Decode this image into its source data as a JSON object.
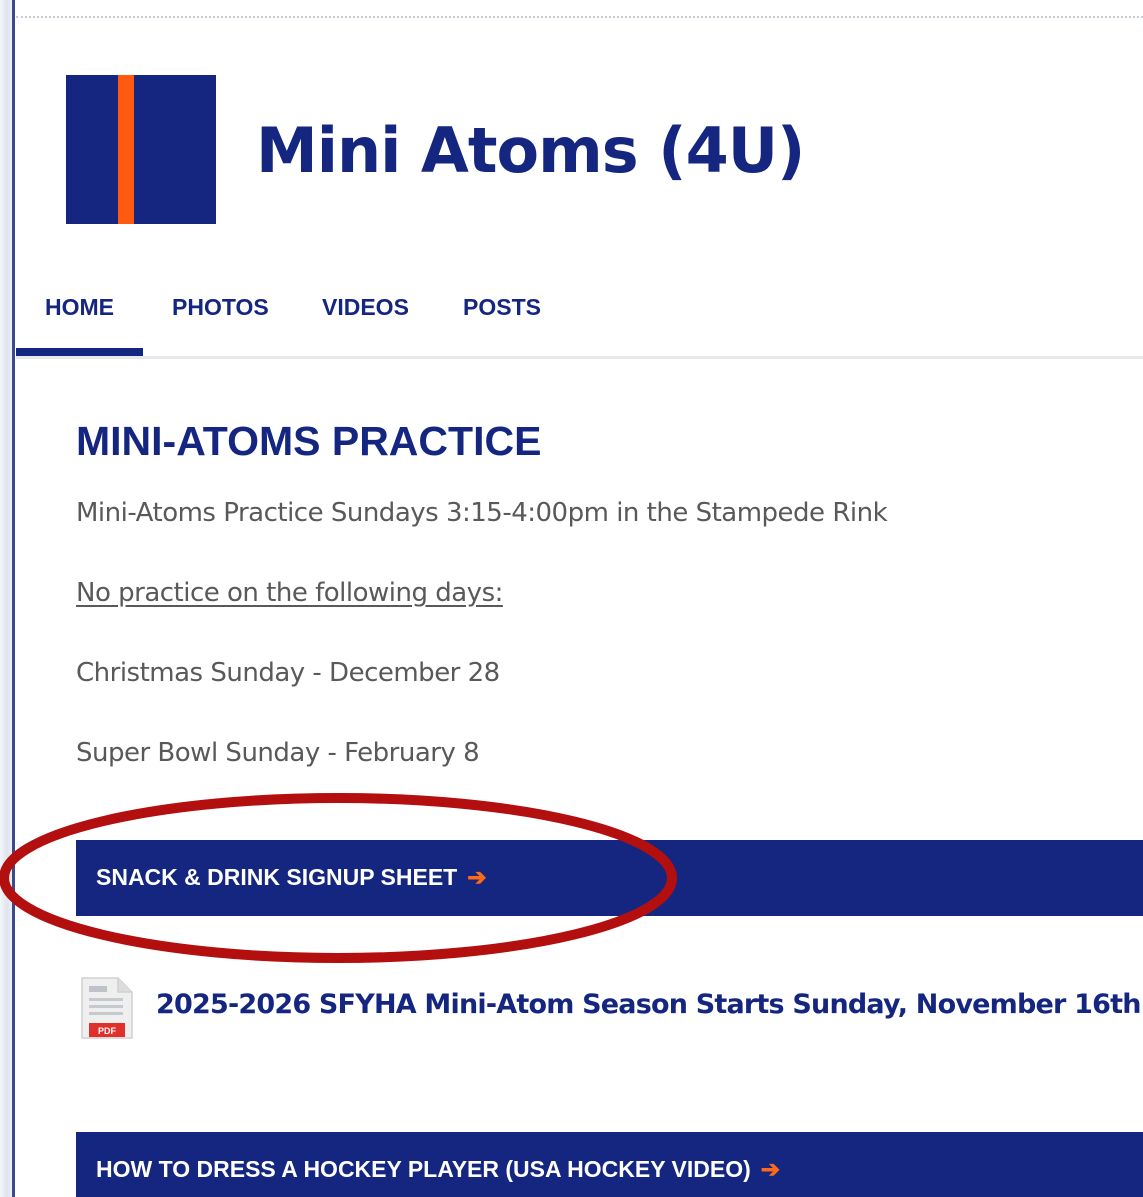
{
  "site": {
    "title": "Mini Atoms (4U)",
    "brand_color": "#14267f",
    "accent_color": "#ff5a10"
  },
  "nav": {
    "items": [
      {
        "label": "HOME",
        "active": true
      },
      {
        "label": "PHOTOS",
        "active": false
      },
      {
        "label": "VIDEOS",
        "active": false
      },
      {
        "label": "POSTS",
        "active": false
      }
    ]
  },
  "content": {
    "heading": "MINI-ATOMS PRACTICE",
    "practice_text": "Mini-Atoms Practice Sundays 3:15-4:00pm in the Stampede Rink",
    "no_practice_label": "No practice on the following days:",
    "no_practice_days": [
      "Christmas Sunday - December 28",
      "Super Bowl Sunday - February 8"
    ],
    "snack_button_label": "SNACK & DRINK SIGNUP SHEET",
    "pdf_icon_label": "PDF",
    "pdf_link_text": "2025-2026 SFYHA Mini-Atom Season Starts Sunday, November 16th",
    "video_button_label": "HOW TO DRESS A HOCKEY PLAYER (USA HOCKEY VIDEO)",
    "arrow_icon": "arrow-right-icon"
  },
  "annotation": {
    "type": "red-ellipse-highlight",
    "color": "#b30f0f"
  }
}
